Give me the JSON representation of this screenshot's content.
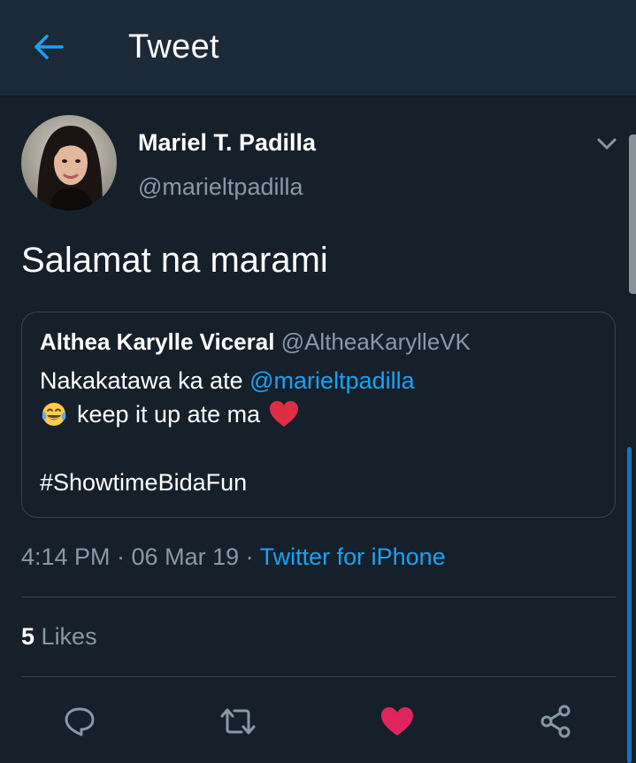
{
  "header": {
    "title": "Tweet",
    "back_icon": "back-arrow-icon"
  },
  "tweet": {
    "author_name": "Mariel T. Padilla",
    "author_handle": "@marieltpadilla",
    "text": "Salamat na marami",
    "timestamp": "4:14 PM · 06 Mar 19 · ",
    "source": "Twitter for iPhone",
    "likes_count": "5",
    "likes_label": "Likes"
  },
  "quoted_tweet": {
    "author_name": "Althea Karylle Viceral",
    "author_handle": "@AltheaKarylleVK",
    "line1_text": "Nakakatawa ka ate ",
    "line1_mention": "@marieltpadilla",
    "line2_text": "keep it up ate ma",
    "line2_emoji_start": "tears-of-joy-emoji",
    "line2_emoji_end": "red-heart-emoji",
    "hashtag": "#ShowtimeBidaFun"
  },
  "actions": [
    "reply-icon",
    "retweet-icon",
    "like-icon",
    "share-icon"
  ],
  "colors": {
    "background": "#15202b",
    "header": "#1c2938",
    "accent": "#1da1f2",
    "muted": "#8899a6",
    "like": "#e0245e",
    "border": "#38444d"
  }
}
